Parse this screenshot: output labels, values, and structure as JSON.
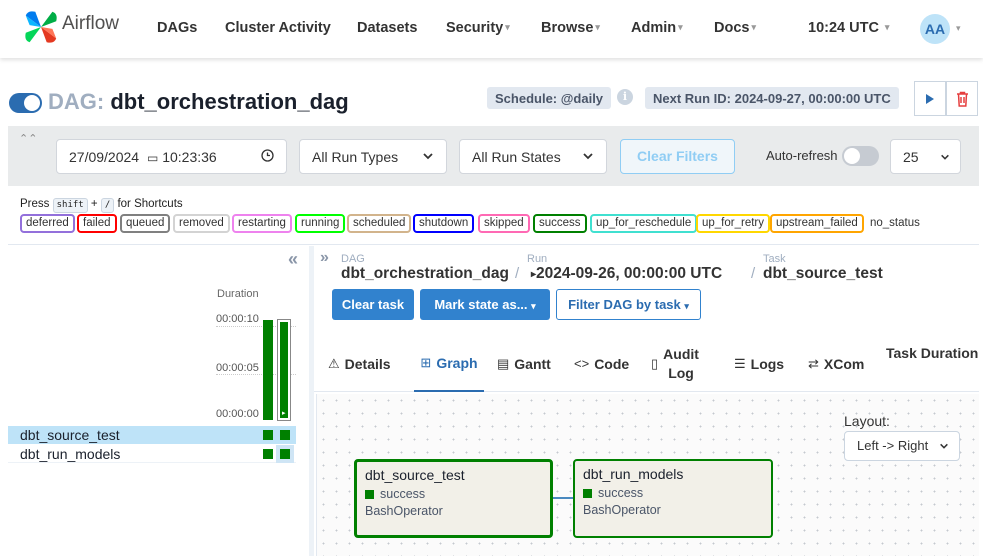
{
  "navbar": {
    "brand": "Airflow",
    "items": [
      {
        "label": "DAGs",
        "dropdown": false
      },
      {
        "label": "Cluster Activity",
        "dropdown": false
      },
      {
        "label": "Datasets",
        "dropdown": false
      },
      {
        "label": "Security",
        "dropdown": true
      },
      {
        "label": "Browse",
        "dropdown": true
      },
      {
        "label": "Admin",
        "dropdown": true
      },
      {
        "label": "Docs",
        "dropdown": true
      }
    ],
    "time": "10:24 UTC",
    "avatar_initials": "AA"
  },
  "dag_header": {
    "prefix": "DAG:",
    "dag_id": "dbt_orchestration_dag",
    "schedule": "Schedule: @daily",
    "next_run": "Next Run ID: 2024-09-27, 00:00:00 UTC",
    "paused": false
  },
  "filters": {
    "datetime": "27/09/2024",
    "time": "10:23:36",
    "run_type": "All Run Types",
    "run_state": "All Run States",
    "clear_label": "Clear Filters",
    "auto_refresh_label": "Auto-refresh",
    "auto_refresh_on": false,
    "page_size": "25"
  },
  "shortcuts": {
    "press": "Press",
    "key1": "shift",
    "plus": "+",
    "key2": "/",
    "suffix": "for Shortcuts"
  },
  "legend": [
    {
      "label": "deferred",
      "color": "#9370db"
    },
    {
      "label": "failed",
      "color": "#ff0000"
    },
    {
      "label": "queued",
      "color": "#808080"
    },
    {
      "label": "removed",
      "color": "#d3d3d3"
    },
    {
      "label": "restarting",
      "color": "#ee82ee"
    },
    {
      "label": "running",
      "color": "#00ff00"
    },
    {
      "label": "scheduled",
      "color": "#d2b48c"
    },
    {
      "label": "shutdown",
      "color": "#0000ff"
    },
    {
      "label": "skipped",
      "color": "#ff69b4"
    },
    {
      "label": "success",
      "color": "#008000"
    },
    {
      "label": "up_for_reschedule",
      "color": "#40e0d0"
    },
    {
      "label": "up_for_retry",
      "color": "#ffd700"
    },
    {
      "label": "upstream_failed",
      "color": "#ffa500"
    },
    {
      "label": "no_status",
      "color": null
    }
  ],
  "grid": {
    "duration_label": "Duration",
    "ticks": [
      "00:00:10",
      "00:00:05",
      "00:00:00"
    ],
    "run_durations_seconds": [
      11,
      11
    ],
    "tasks": [
      {
        "name": "dbt_source_test",
        "selected": true
      },
      {
        "name": "dbt_run_models",
        "selected": false
      }
    ]
  },
  "breadcrumb": {
    "dag_label": "DAG",
    "dag_value": "dbt_orchestration_dag",
    "run_label": "Run",
    "run_value": "2024-09-26, 00:00:00 UTC",
    "task_label": "Task",
    "task_value": "dbt_source_test"
  },
  "actions": {
    "clear_task": "Clear task",
    "mark_state": "Mark state as...",
    "filter_dag": "Filter DAG by task"
  },
  "tabs": [
    {
      "label": "Details",
      "icon": "warning-icon"
    },
    {
      "label": "Graph",
      "icon": "graph-icon",
      "active": true
    },
    {
      "label": "Gantt",
      "icon": "gantt-icon"
    },
    {
      "label": "Code",
      "icon": "code-icon"
    },
    {
      "label": "Audit",
      "label2": "Log",
      "icon": "file-icon"
    },
    {
      "label": "Logs",
      "icon": "list-icon"
    },
    {
      "label": "XCom",
      "icon": "swap-icon"
    },
    {
      "label": "Task Duration"
    }
  ],
  "graph": {
    "layout_label": "Layout:",
    "layout_value": "Left -> Right",
    "nodes": [
      {
        "name": "dbt_source_test",
        "state": "success",
        "operator": "BashOperator",
        "selected": true
      },
      {
        "name": "dbt_run_models",
        "state": "success",
        "operator": "BashOperator",
        "selected": false
      }
    ]
  },
  "colors": {
    "accent": "#3182ce",
    "success": "#008000"
  }
}
